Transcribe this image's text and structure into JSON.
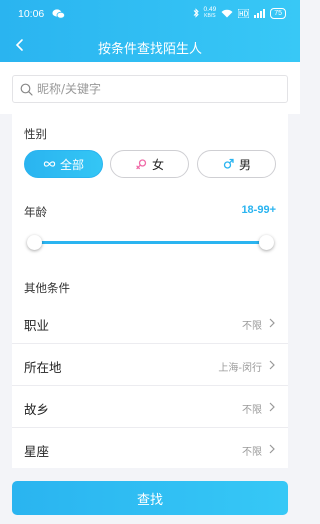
{
  "status_bar": {
    "time": "10:06",
    "speed_value": "0.49",
    "speed_unit": "KB/S",
    "battery": "75",
    "icons": [
      "wechat-icon",
      "bluetooth-icon",
      "wifi-icon",
      "hd-signal-icon",
      "signal-icon",
      "battery-icon"
    ]
  },
  "nav": {
    "title": "按条件查找陌生人",
    "back_icon": "chevron-left-icon"
  },
  "search": {
    "placeholder": "昵称/关键字",
    "value": ""
  },
  "gender": {
    "label": "性别",
    "options": [
      {
        "label": "全部",
        "icon": "infinity-icon",
        "selected": true
      },
      {
        "label": "女",
        "icon": "female-icon",
        "selected": false,
        "color": "#f06ba8"
      },
      {
        "label": "男",
        "icon": "male-icon",
        "selected": false,
        "color": "#2ab4f0"
      }
    ]
  },
  "age": {
    "label": "年龄",
    "value": "18-99+",
    "min": 18,
    "max": 99
  },
  "other": {
    "label": "其他条件",
    "rows": [
      {
        "label": "职业",
        "value": "不限"
      },
      {
        "label": "所在地",
        "value": "上海-闵行"
      },
      {
        "label": "故乡",
        "value": "不限"
      },
      {
        "label": "星座",
        "value": "不限"
      }
    ]
  },
  "submit_label": "查找",
  "colors": {
    "accent": "#2ab4f0",
    "background": "#f3f4f8"
  }
}
